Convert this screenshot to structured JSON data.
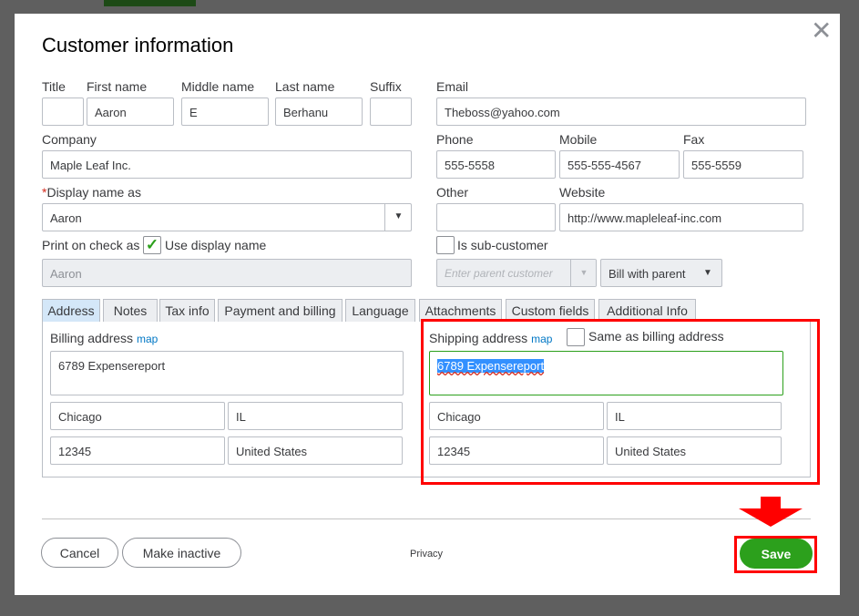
{
  "dialog": {
    "title": "Customer information"
  },
  "name": {
    "title_label": "Title",
    "first_label": "First name",
    "middle_label": "Middle name",
    "last_label": "Last name",
    "suffix_label": "Suffix",
    "title": "",
    "first": "Aaron",
    "middle": "E",
    "last": "Berhanu",
    "suffix": ""
  },
  "company": {
    "label": "Company",
    "value": "Maple Leaf Inc."
  },
  "display_name": {
    "required": "*",
    "label": "Display name as",
    "value": "Aaron"
  },
  "print_on_check": {
    "label": "Print on check as",
    "checkbox_label": "Use display name",
    "checked": true,
    "value": "Aaron"
  },
  "email": {
    "label": "Email",
    "value": "Theboss@yahoo.com"
  },
  "phone": {
    "label": "Phone",
    "value": "555-5558"
  },
  "mobile": {
    "label": "Mobile",
    "value": "555-555-4567"
  },
  "fax": {
    "label": "Fax",
    "value": "555-5559"
  },
  "other": {
    "label": "Other",
    "value": ""
  },
  "website": {
    "label": "Website",
    "value": "http://www.mapleleaf-inc.com"
  },
  "sub_customer": {
    "label": "Is sub-customer",
    "checked": false,
    "parent_placeholder": "Enter parent customer",
    "bill_with": "Bill with parent"
  },
  "tabs": [
    {
      "label": "Address"
    },
    {
      "label": "Notes"
    },
    {
      "label": "Tax info"
    },
    {
      "label": "Payment and billing"
    },
    {
      "label": "Language"
    },
    {
      "label": "Attachments"
    },
    {
      "label": "Custom fields"
    },
    {
      "label": "Additional Info"
    }
  ],
  "billing": {
    "label": "Billing address",
    "map": "map",
    "street": "6789 Expensereport",
    "city": "Chicago",
    "state": "IL",
    "zip": "12345",
    "country": "United States"
  },
  "shipping": {
    "label": "Shipping address",
    "map": "map",
    "same_label": "Same as billing address",
    "same_checked": false,
    "street": "6789 Expensereport",
    "city": "Chicago",
    "state": "IL",
    "zip": "12345",
    "country": "United States"
  },
  "footer": {
    "cancel": "Cancel",
    "make_inactive": "Make inactive",
    "privacy": "Privacy",
    "save": "Save"
  },
  "colors": {
    "save": "#2ca01c",
    "annotation": "#ff0000",
    "active_tab": "#d4e7f8",
    "link": "#0077c5"
  }
}
